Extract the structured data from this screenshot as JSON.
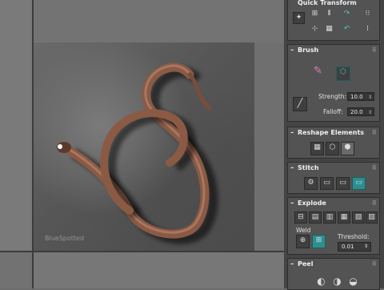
{
  "watermark": "BlueSpotted",
  "rollouts": {
    "quick": {
      "title": "Quick Transform",
      "grip": "⠿"
    },
    "brush": {
      "title": "Brush",
      "minus": "–",
      "grip": "⠿",
      "strength_label": "Strength:",
      "strength_value": "10.0",
      "falloff_label": "Falloff:",
      "falloff_value": "20.0"
    },
    "reshape": {
      "title": "Reshape Elements",
      "minus": "–",
      "grip": "⠿"
    },
    "stitch": {
      "title": "Stitch",
      "minus": "–",
      "grip": "⠿"
    },
    "explode": {
      "title": "Explode",
      "minus": "–",
      "grip": "⠿",
      "weld_label": "Weld",
      "threshold_label": "Threshold:",
      "threshold_value": "0.01"
    },
    "peel": {
      "title": "Peel",
      "minus": "–",
      "grip": "⠿"
    }
  },
  "colors": {
    "accent": "#2c8e8e",
    "panel": "#444444",
    "rollout": "#535353",
    "snake": "#8a5a44"
  },
  "icons": {
    "qt": [
      "pivot-icon",
      "align-horizontal-icon",
      "align-vertical-icon",
      "rotate-cw-icon",
      "space-horizontal-icon",
      "align-center-icon",
      "checker-icon",
      "rotate-ccw-icon",
      "space-vertical-icon"
    ],
    "brush": [
      "paint-brush-icon",
      "cube-brush-icon",
      "pen-line-icon"
    ],
    "reshape": [
      "grid-reshape-icon",
      "relax-cube-icon",
      "cube-icon"
    ],
    "stitch": [
      "stitch-1-icon",
      "stitch-2-icon",
      "stitch-3-icon",
      "stitch-4-icon"
    ],
    "explode": [
      "explode-1-icon",
      "explode-2-icon",
      "explode-3-icon",
      "explode-4-icon",
      "explode-5-icon",
      "explode-6-icon"
    ],
    "weld": [
      "weld-target-icon",
      "weld-selected-icon"
    ],
    "peel": [
      "peel-1-icon",
      "peel-2-icon",
      "peel-3-icon"
    ]
  }
}
